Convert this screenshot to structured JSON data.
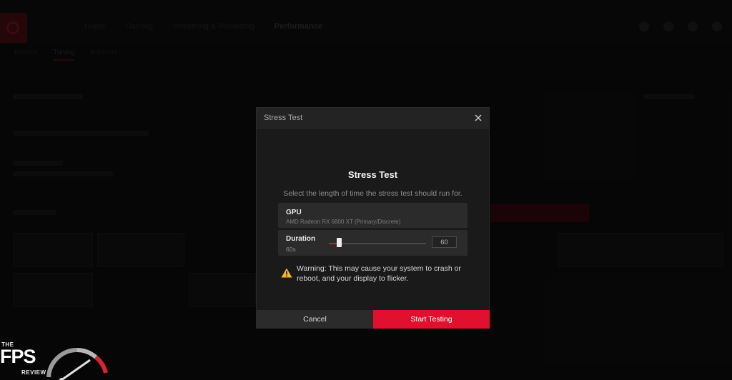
{
  "background_app": {
    "top_nav": [
      "Home",
      "Gaming",
      "Streaming & Recording",
      "Performance"
    ],
    "sub_nav": [
      "Metrics",
      "Tuning",
      "Advisors"
    ]
  },
  "dialog": {
    "header_title": "Stress Test",
    "title": "Stress Test",
    "description": "Select the length of time the stress test should run for.",
    "gpu": {
      "label": "GPU",
      "name": "AMD Radeon RX 6800 XT (Primary/Discrete)"
    },
    "duration": {
      "label": "Duration",
      "value_text": "60s",
      "input_value": "60",
      "slider_fraction": 0.1
    },
    "warning": {
      "line1": "Warning: This may cause your system to crash or",
      "line2": "reboot, and your display to flicker."
    },
    "buttons": {
      "cancel": "Cancel",
      "start": "Start Testing"
    }
  },
  "watermark": {
    "the": "THE",
    "fps": "FPS",
    "review": "REVIEW"
  },
  "colors": {
    "accent": "#e0102e",
    "dialog_bg": "#1a1a1a",
    "row_bg": "#2b2b2b",
    "warning": "#f2b632"
  },
  "icons": {
    "close": "close-icon",
    "warning": "warning-icon",
    "watermark": "fps-review-gauge-logo"
  }
}
